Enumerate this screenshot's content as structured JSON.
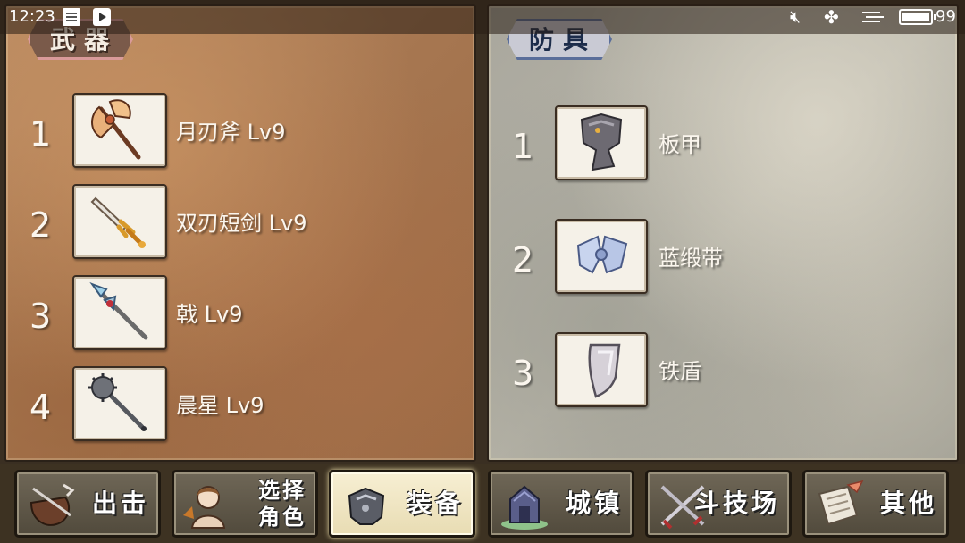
{
  "status_bar": {
    "time": "12:23",
    "battery_level": "99",
    "icons": [
      "note-icon",
      "play-icon",
      "mute-icon",
      "fan-icon",
      "menu-icon",
      "battery-icon"
    ]
  },
  "weapons_panel": {
    "tab_label": "武器",
    "items": [
      {
        "index": "1",
        "name": "月刃斧 Lv9",
        "icon": "moon-axe-icon"
      },
      {
        "index": "2",
        "name": "双刃短剑 Lv9",
        "icon": "twin-blade-dagger-icon"
      },
      {
        "index": "3",
        "name": "戟 Lv9",
        "icon": "halberd-icon"
      },
      {
        "index": "4",
        "name": "晨星 Lv9",
        "icon": "morning-star-icon"
      }
    ]
  },
  "armor_panel": {
    "tab_label": "防具",
    "items": [
      {
        "index": "1",
        "name": "板甲",
        "icon": "plate-armor-icon"
      },
      {
        "index": "2",
        "name": "蓝缎带",
        "icon": "blue-ribbon-icon"
      },
      {
        "index": "3",
        "name": "铁盾",
        "icon": "iron-shield-icon"
      }
    ]
  },
  "nav": [
    {
      "label": "出击",
      "icon": "sortie-icon",
      "active": false
    },
    {
      "label": "选择\n角色",
      "icon": "character-select-icon",
      "active": false
    },
    {
      "label": "装备",
      "icon": "equipment-icon",
      "active": true
    },
    {
      "label": "城镇",
      "icon": "town-icon",
      "active": false
    },
    {
      "label": "斗技场",
      "icon": "arena-icon",
      "active": false
    },
    {
      "label": "其他",
      "icon": "other-scroll-icon",
      "active": false
    }
  ],
  "colors": {
    "weapons_panel_bg": "#a67650",
    "armor_panel_bg": "#b9b6aa",
    "nav_active_bg": "#f0e6c4",
    "weapons_tab_border": "#d99a9a",
    "armor_tab_border": "#5a6e9a"
  }
}
